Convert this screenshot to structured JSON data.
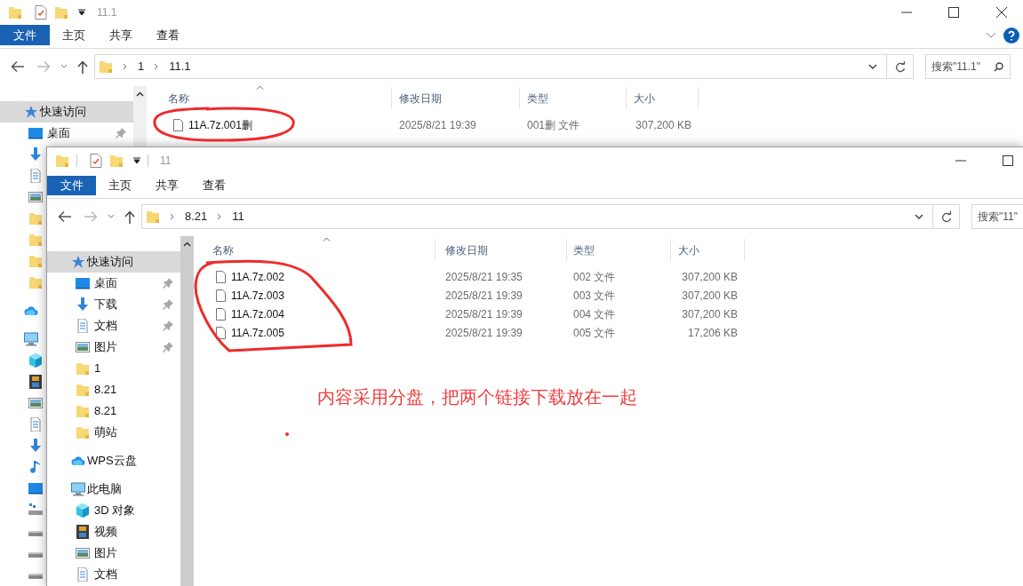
{
  "windows": [
    {
      "kind": "back",
      "title": "11.1",
      "ribbon_tabs": [
        {
          "label": "文件",
          "kind": "menu"
        },
        {
          "label": "主页",
          "kind": "tab"
        },
        {
          "label": "共享",
          "kind": "tab"
        },
        {
          "label": "查看",
          "kind": "tab"
        }
      ],
      "address": {
        "path": [
          "1",
          "11.1"
        ]
      },
      "search": {
        "placeholder": "搜索\"11.1\""
      },
      "nav": [
        {
          "label": "快速访问",
          "kind": "star",
          "selected": true,
          "children": [
            {
              "label": "桌面",
              "kind": "desktop",
              "pinned": true
            },
            {
              "kind": "download"
            },
            {
              "kind": "doc"
            },
            {
              "kind": "picture"
            },
            {
              "kind": "folder"
            },
            {
              "kind": "folder"
            },
            {
              "kind": "folder"
            },
            {
              "kind": "folder"
            }
          ]
        },
        {
          "kind": "cloud"
        },
        {
          "kind": "pc",
          "children": [
            {
              "kind": "cube"
            },
            {
              "kind": "video"
            },
            {
              "kind": "picture"
            },
            {
              "kind": "doc"
            },
            {
              "kind": "download"
            },
            {
              "kind": "music"
            },
            {
              "kind": "desktop"
            },
            {
              "kind": "netdrive"
            },
            {
              "kind": "drive"
            },
            {
              "kind": "drive"
            },
            {
              "kind": "drive"
            }
          ]
        }
      ],
      "columns": [
        {
          "label": "名称",
          "sorted": true
        },
        {
          "label": "修改日期",
          "sorted": false
        },
        {
          "label": "类型",
          "sorted": false
        },
        {
          "label": "大小",
          "sorted": false
        }
      ],
      "files": [
        {
          "name": "11A.7z.001删",
          "modified": "2025/8/21 19:39",
          "type": "001删 文件",
          "size": "307,200 KB"
        }
      ]
    },
    {
      "kind": "front",
      "title": "11",
      "ribbon_tabs": [
        {
          "label": "文件",
          "kind": "menu"
        },
        {
          "label": "主页",
          "kind": "tab"
        },
        {
          "label": "共享",
          "kind": "tab"
        },
        {
          "label": "查看",
          "kind": "tab"
        }
      ],
      "address": {
        "path": [
          "8.21",
          "11"
        ]
      },
      "search": {
        "placeholder": "搜索\"11\""
      },
      "nav": [
        {
          "label": "快速访问",
          "kind": "star",
          "selected": true,
          "children": [
            {
              "label": "桌面",
              "kind": "desktop",
              "pinned": true
            },
            {
              "label": "下载",
              "kind": "download",
              "pinned": true
            },
            {
              "label": "文档",
              "kind": "doc",
              "pinned": true
            },
            {
              "label": "图片",
              "kind": "picture",
              "pinned": true
            },
            {
              "label": "1",
              "kind": "folder",
              "pinned": false
            },
            {
              "label": "8.21",
              "kind": "folder",
              "pinned": false
            },
            {
              "label": "8.21",
              "kind": "folder",
              "pinned": false
            },
            {
              "label": "萌站",
              "kind": "folder",
              "pinned": false
            }
          ]
        },
        {
          "label": "WPS云盘",
          "kind": "cloud",
          "selected": false
        },
        {
          "label": "此电脑",
          "kind": "pc",
          "selected": false,
          "children": [
            {
              "label": "3D 对象",
              "kind": "cube",
              "pinned": false
            },
            {
              "label": "视频",
              "kind": "video",
              "pinned": false
            },
            {
              "label": "图片",
              "kind": "picture",
              "pinned": false
            },
            {
              "label": "文档",
              "kind": "doc",
              "pinned": false
            }
          ]
        }
      ],
      "columns": [
        {
          "label": "名称",
          "sorted": true
        },
        {
          "label": "修改日期",
          "sorted": false
        },
        {
          "label": "类型",
          "sorted": false
        },
        {
          "label": "大小",
          "sorted": false
        }
      ],
      "files": [
        {
          "name": "11A.7z.002",
          "modified": "2025/8/21 19:35",
          "type": "002 文件",
          "size": "307,200 KB"
        },
        {
          "name": "11A.7z.003",
          "modified": "2025/8/21 19:39",
          "type": "003 文件",
          "size": "307,200 KB"
        },
        {
          "name": "11A.7z.004",
          "modified": "2025/8/21 19:39",
          "type": "004 文件",
          "size": "307,200 KB"
        },
        {
          "name": "11A.7z.005",
          "modified": "2025/8/21 19:39",
          "type": "005 文件",
          "size": "17,206 KB"
        }
      ]
    }
  ],
  "annotation": {
    "text": "内容采用分盘，把两个链接下载放在一起"
  }
}
